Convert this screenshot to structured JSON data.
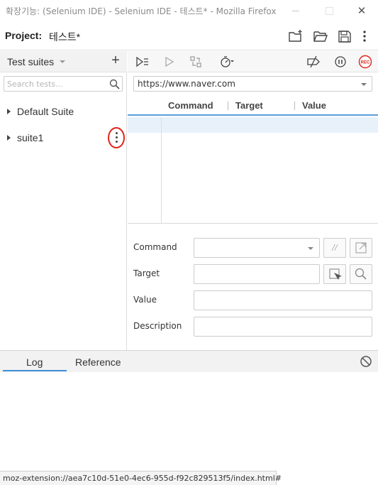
{
  "window": {
    "title": "확장기능: (Selenium IDE) - Selenium IDE - 테스트* - Mozilla Firefox",
    "close_glyph": "✕"
  },
  "project": {
    "label": "Project:",
    "name": "테스트*",
    "icons": [
      "new-project-icon",
      "open-project-icon",
      "save-project-icon",
      "more-vertical-icon"
    ]
  },
  "sidebar": {
    "title": "Test suites",
    "add_glyph": "+",
    "search_placeholder": "Search tests...",
    "suites": [
      {
        "label": "Default Suite"
      },
      {
        "label": "suite1"
      }
    ]
  },
  "toolbar": {
    "icons": [
      "run-all-tests-icon",
      "run-current-test-icon",
      "step-over-icon",
      "speed-timer-icon",
      "disable-breakpoints-icon",
      "pause-on-exceptions-icon",
      "record-icon"
    ],
    "record_label": "REC"
  },
  "editor": {
    "base_url": "https://www.naver.com",
    "columns": [
      "Command",
      "Target",
      "Value"
    ]
  },
  "command_details": {
    "command_label": "Command",
    "target_label": "Target",
    "value_label": "Value",
    "description_label": "Description",
    "comment_button": "//"
  },
  "bottom_panel": {
    "tabs": [
      "Log",
      "Reference"
    ],
    "active_tab": "Log"
  },
  "status_bar": {
    "url": "moz-extension://aea7c10d-51e0-4ec6-955d-f92c829513f5/index.html#"
  },
  "colors": {
    "accent_blue": "#3d8fd6",
    "record_red": "#e0241b",
    "highlight_circle": "#e0241b"
  }
}
